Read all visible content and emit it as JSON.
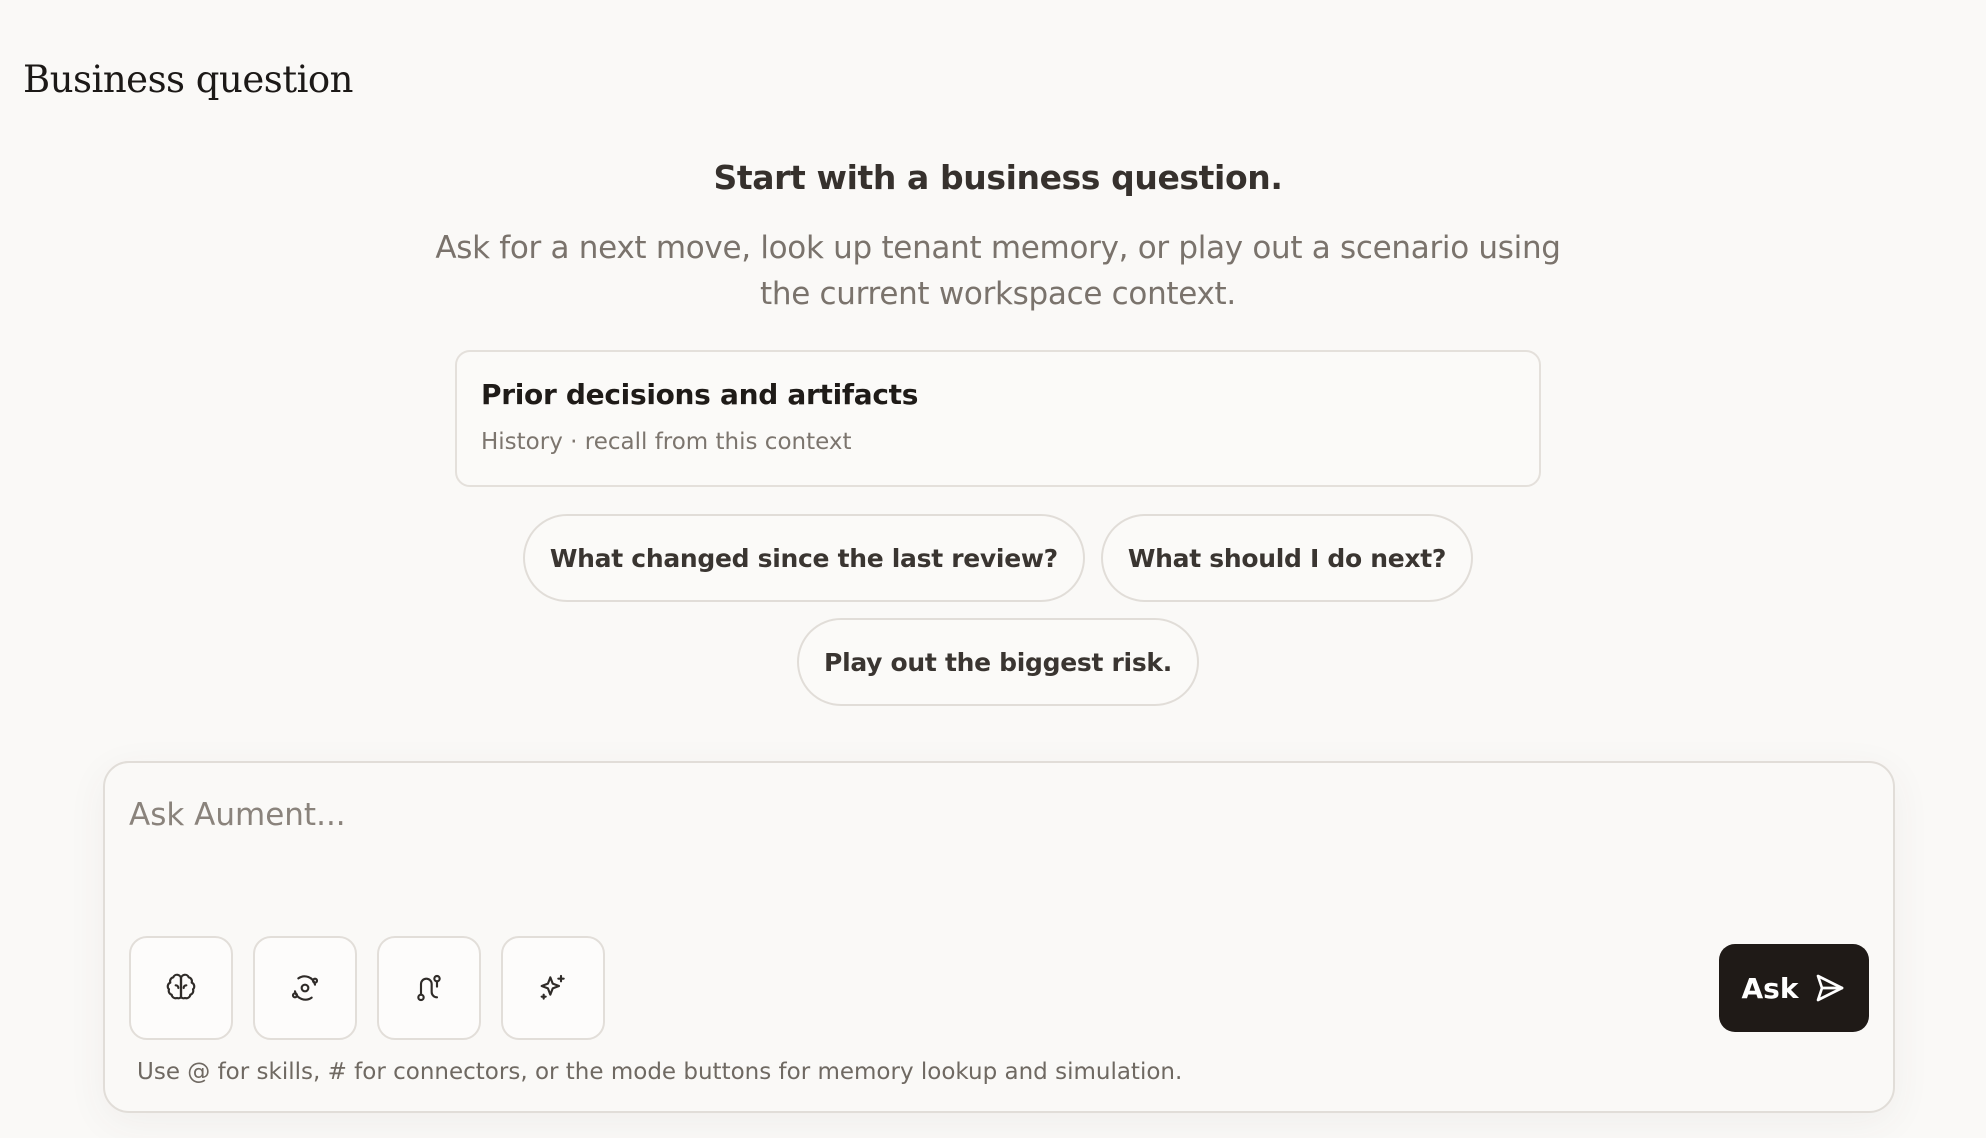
{
  "page": {
    "title": "Business question"
  },
  "hero": {
    "heading": "Start with a business question.",
    "subtitle": "Ask for a next move, look up tenant memory, or play out a scenario using the current workspace context."
  },
  "recall_card": {
    "title": "Prior decisions and artifacts",
    "subtitle": "History · recall from this context"
  },
  "suggestions": [
    {
      "label": "What changed since the last review?"
    },
    {
      "label": "What should I do next?"
    },
    {
      "label": "Play out the biggest risk."
    }
  ],
  "composer": {
    "placeholder": "Ask Aument...",
    "value": "",
    "mode_buttons": [
      {
        "icon": "brain-icon"
      },
      {
        "icon": "orbit-icon"
      },
      {
        "icon": "route-icon"
      },
      {
        "icon": "sparkles-icon"
      }
    ],
    "ask_label": "Ask",
    "ask_icon": "send-icon",
    "hint": "Use @ for skills, # for connectors, or the mode buttons for memory lookup and simulation."
  },
  "colors": {
    "background": "#faf9f7",
    "accent": "#1f1a17",
    "border": "#e1ddd8",
    "muted_text": "#7a736c"
  }
}
